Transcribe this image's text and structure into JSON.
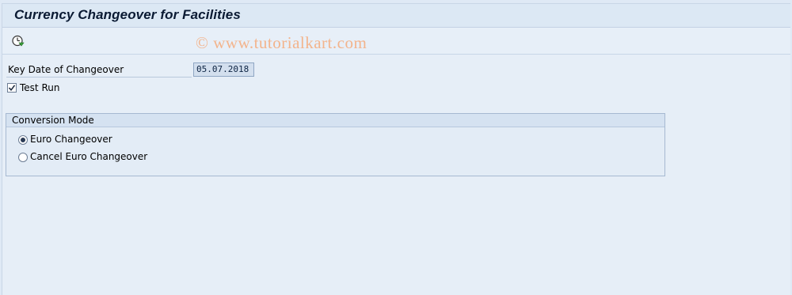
{
  "header": {
    "title": "Currency Changeover for Facilities"
  },
  "toolbar": {
    "execute_icon": "execute-clock-icon"
  },
  "watermark": "© www.tutorialkart.com",
  "form": {
    "key_date_label": "Key Date of Changeover",
    "key_date_value": "05.07.2018",
    "test_run_label": "Test Run",
    "test_run_checked": true
  },
  "conversion_mode": {
    "title": "Conversion Mode",
    "options": [
      {
        "label": "Euro Changeover",
        "selected": true
      },
      {
        "label": "Cancel Euro Changeover",
        "selected": false
      }
    ]
  },
  "colors": {
    "background": "#e6eef7",
    "title_bar": "#dce8f4",
    "watermark": "#f3b48c"
  }
}
